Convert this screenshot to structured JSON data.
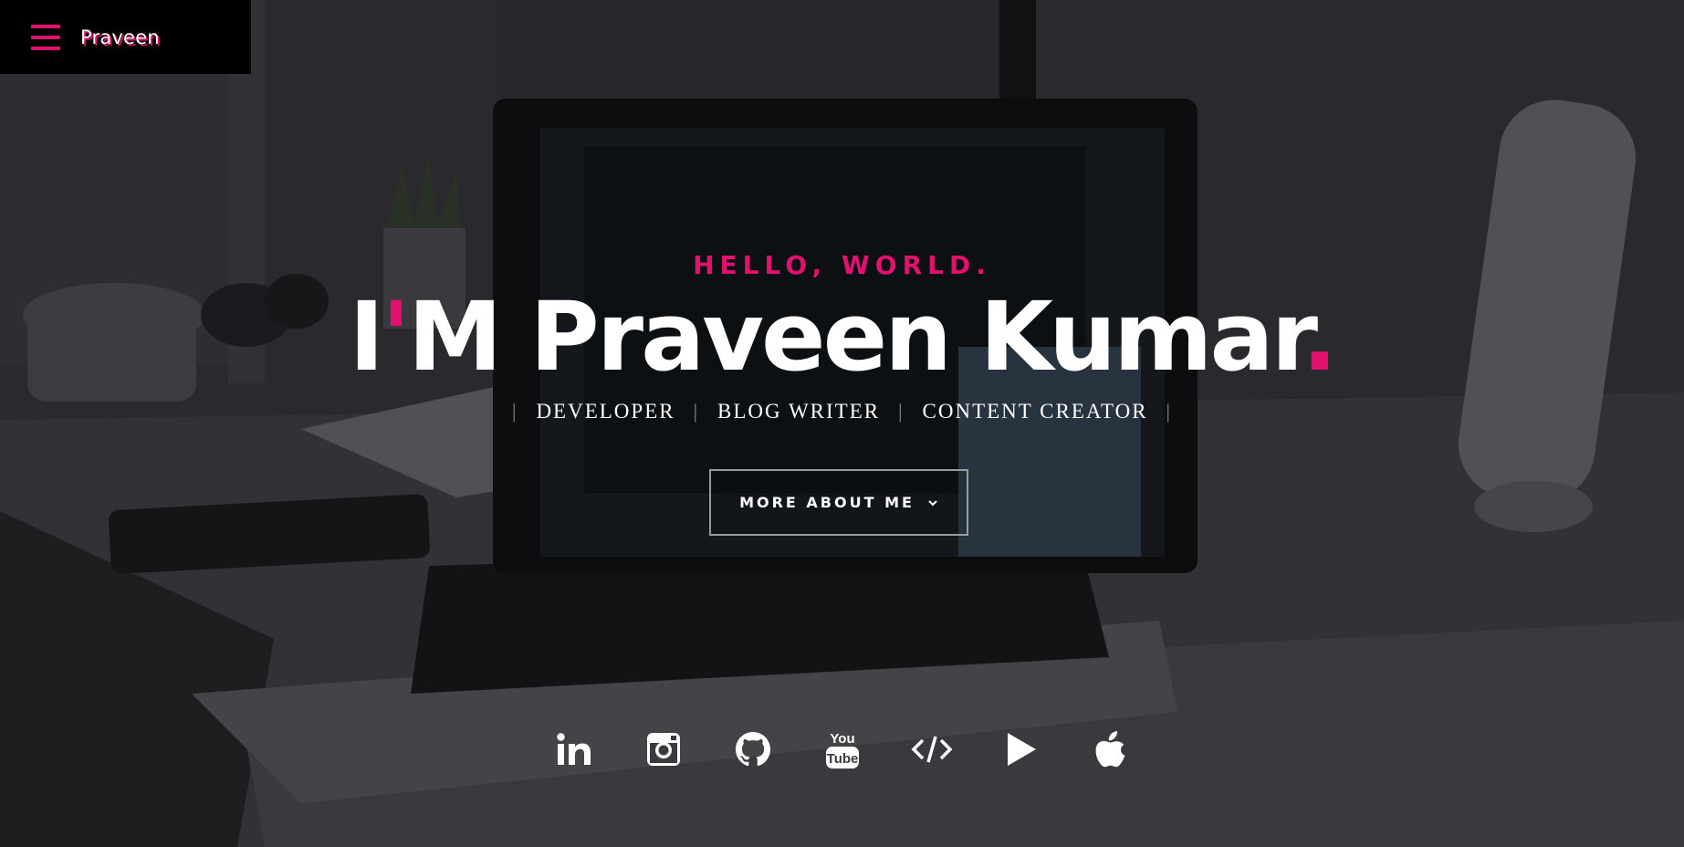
{
  "nav": {
    "brand": "Praveen",
    "menu_icon": "hamburger-icon",
    "accent_color": "#e0116f"
  },
  "hero": {
    "greeting": "HELLO, WORLD.",
    "name_prefix": "I",
    "name_apostrophe": "'",
    "name_middle": "M Praveen Kumar",
    "name_dot": ".",
    "roles": [
      "DEVELOPER",
      "BLOG WRITER",
      "CONTENT CREATOR"
    ],
    "separator": "|",
    "cta_label": "MORE ABOUT ME",
    "cta_icon": "chevron-down-icon"
  },
  "social": [
    {
      "name": "linkedin",
      "icon": "linkedin-icon"
    },
    {
      "name": "instagram",
      "icon": "instagram-icon"
    },
    {
      "name": "github",
      "icon": "github-icon"
    },
    {
      "name": "youtube",
      "icon": "youtube-icon",
      "text_top": "You",
      "text_bottom": "Tube"
    },
    {
      "name": "code",
      "icon": "code-icon",
      "text": "</>"
    },
    {
      "name": "play-store",
      "icon": "play-icon"
    },
    {
      "name": "apple",
      "icon": "apple-icon"
    }
  ]
}
